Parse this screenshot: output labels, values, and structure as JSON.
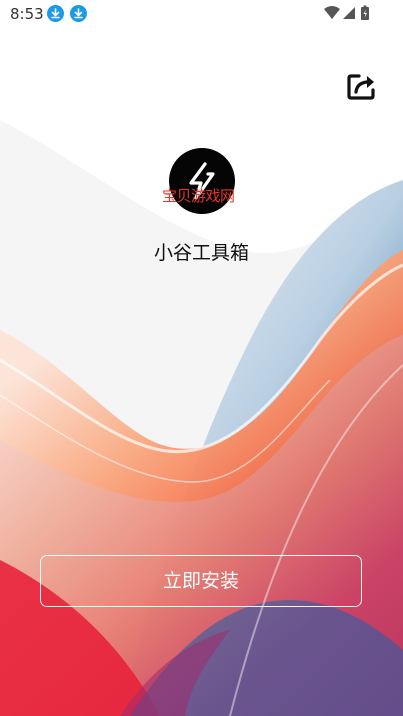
{
  "status_bar": {
    "time": "8:53",
    "notification_icons": [
      "download-icon",
      "download-icon"
    ],
    "system_icons": [
      "wifi-icon",
      "signal-icon",
      "battery-charging-icon"
    ],
    "accent_color": "#1a9be8"
  },
  "app": {
    "icon": "lightning-bolt-icon",
    "watermark": "宝贝游戏网",
    "name": "小谷工具箱"
  },
  "toolbar": {
    "share_icon": "share-icon"
  },
  "actions": {
    "install_label": "立即安装"
  },
  "colors": {
    "watermark": "#e2352c",
    "icon_background": "#050505",
    "gradient_red": "#ee3a3a",
    "gradient_orange": "#f9764a",
    "gradient_blue": "#1f5fa3"
  }
}
